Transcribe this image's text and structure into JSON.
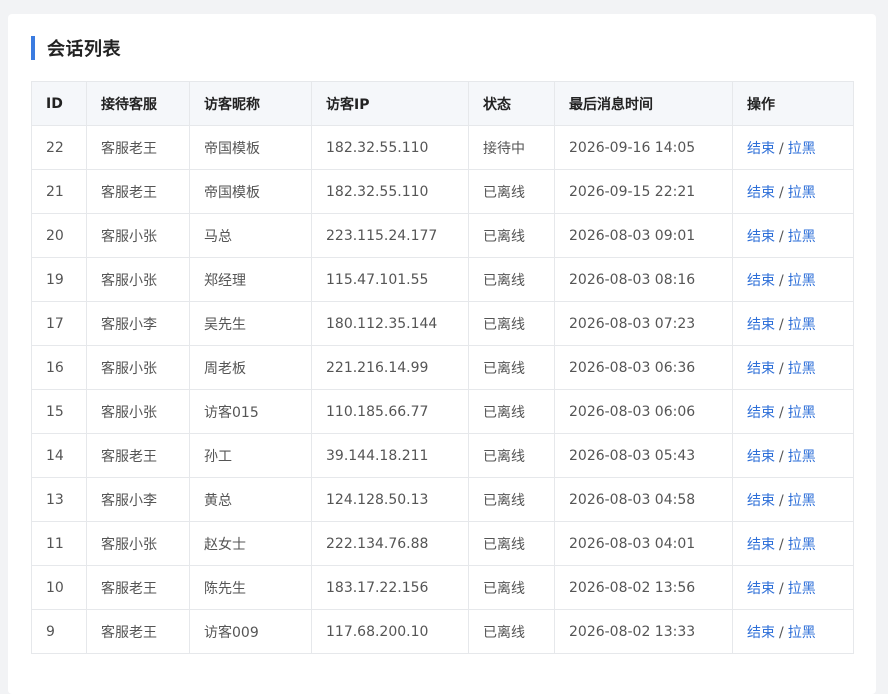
{
  "card": {
    "title": "会话列表"
  },
  "table": {
    "headers": [
      "ID",
      "接待客服",
      "访客昵称",
      "访客IP",
      "状态",
      "最后消息时间",
      "操作"
    ],
    "actions": {
      "end": "结束",
      "separator": "/",
      "block": "拉黑"
    },
    "rows": [
      [
        "22",
        "客服老王",
        "帝国模板",
        "182.32.55.110",
        "接待中",
        "2026-09-16 14:05"
      ],
      [
        "21",
        "客服老王",
        "帝国模板",
        "182.32.55.110",
        "已离线",
        "2026-09-15 22:21"
      ],
      [
        "20",
        "客服小张",
        "马总",
        "223.115.24.177",
        "已离线",
        "2026-08-03 09:01"
      ],
      [
        "19",
        "客服小张",
        "郑经理",
        "115.47.101.55",
        "已离线",
        "2026-08-03 08:16"
      ],
      [
        "17",
        "客服小李",
        "吴先生",
        "180.112.35.144",
        "已离线",
        "2026-08-03 07:23"
      ],
      [
        "16",
        "客服小张",
        "周老板",
        "221.216.14.99",
        "已离线",
        "2026-08-03 06:36"
      ],
      [
        "15",
        "客服小张",
        "访客015",
        "110.185.66.77",
        "已离线",
        "2026-08-03 06:06"
      ],
      [
        "14",
        "客服老王",
        "孙工",
        "39.144.18.211",
        "已离线",
        "2026-08-03 05:43"
      ],
      [
        "13",
        "客服小李",
        "黄总",
        "124.128.50.13",
        "已离线",
        "2026-08-03 04:58"
      ],
      [
        "11",
        "客服小张",
        "赵女士",
        "222.134.76.88",
        "已离线",
        "2026-08-03 04:01"
      ],
      [
        "10",
        "客服老王",
        "陈先生",
        "183.17.22.156",
        "已离线",
        "2026-08-02 13:56"
      ],
      [
        "9",
        "客服老王",
        "访客009",
        "117.68.200.10",
        "已离线",
        "2026-08-02 13:33"
      ]
    ]
  },
  "colors": {
    "accent": "#3a7be0",
    "link": "#2e6fd8"
  }
}
